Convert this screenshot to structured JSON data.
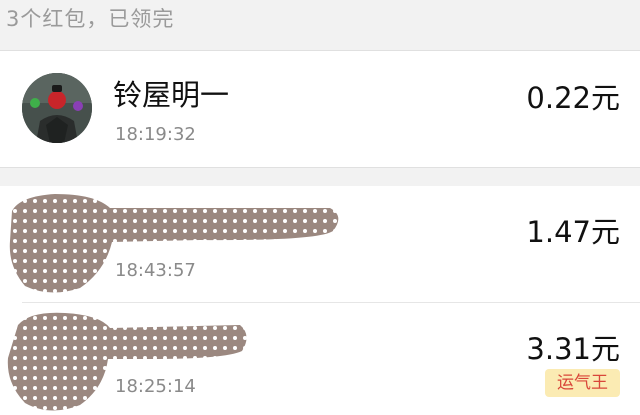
{
  "header": {
    "summary": "3个红包，已领完"
  },
  "records": [
    {
      "name": "铃屋明一",
      "time": "18:19:32",
      "amount": "0.22元",
      "badge": ""
    },
    {
      "name": "",
      "time": "18:43:57",
      "amount": "1.47元",
      "badge": ""
    },
    {
      "name": "",
      "time": "18:25:14",
      "amount": "3.31元",
      "badge": "运气王"
    }
  ],
  "icons": {
    "avatar": "user-avatar",
    "redaction": "redaction-scribble"
  },
  "colors": {
    "badge_bg": "#fbebb3",
    "badge_text": "#d9473a",
    "redaction": "#9b8880"
  }
}
